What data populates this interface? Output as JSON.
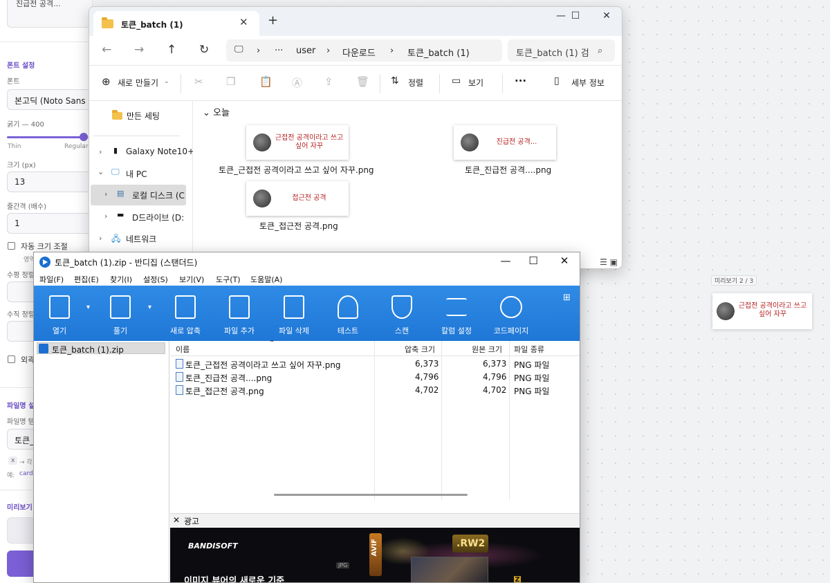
{
  "left_panel": {
    "top_box_text": "진급전 공격...",
    "font_section": "폰트 설정",
    "font_label": "폰트",
    "font_value": "본고딕 (Noto Sans KR)",
    "weight_label": "굵기 — 400",
    "weight_level": 0.8,
    "weight_min": "Thin",
    "weight_mid": "Regular",
    "size_label": "크기 (px)",
    "size_value": "13",
    "line_label": "줄간격 (배수)",
    "line_value": "1",
    "autosize_label": "자동 크기 조절",
    "autosize_sub": "영역",
    "halign_label": "수평 정렬",
    "valign_label": "수직 정렬",
    "outline_label": "외곽",
    "filename_section": "파일명 설",
    "filename_template_label": "파일명 템",
    "filename_value": "토큰_",
    "hint_tag": "x",
    "hint_text": "→ 각",
    "example_label": "예:",
    "example_value": "card",
    "preview_section": "미리보기"
  },
  "explorer": {
    "tab_title": "토큰_batch (1)",
    "tab_close": "✕",
    "new_tab": "+",
    "breadcrumb": [
      "user",
      "다운로드",
      "토큰_batch (1)"
    ],
    "ellipsis": "···",
    "search_placeholder": "토큰_batch (1) 검",
    "toolbar": {
      "new": "새로 만들기",
      "sort": "정렬",
      "view": "보기",
      "more": "···",
      "details": "세부 정보"
    },
    "nav": {
      "made_settings": "만든 세팅",
      "galaxy": "Galaxy Note10+",
      "my_pc": "내 PC",
      "local_disk": "로컬 디스크 (C",
      "d_drive": "D드라이브 (D:",
      "network": "네트워크"
    },
    "group_header": "오늘",
    "files": [
      {
        "thumb_text": "근접전 공격이라고 쓰고 싶어 자꾸",
        "name": "토큰_근접전 공격이라고 쓰고 싶어 자꾸.png"
      },
      {
        "thumb_text": "진급전 공격...",
        "name": "토큰_진급전 공격....png"
      },
      {
        "thumb_text": "접근전 공격",
        "name": "토큰_접근전 공격.png"
      }
    ]
  },
  "preview": {
    "label": "미리보기 2 / 3",
    "text": "근접전 공격이라고 쓰고 싶어 자꾸"
  },
  "bandizip": {
    "title": "토큰_batch (1).zip - 반디집 (스탠더드)",
    "menu": [
      "파일(F)",
      "편집(E)",
      "찾기(I)",
      "설정(S)",
      "보기(V)",
      "도구(T)",
      "도움말(A)"
    ],
    "ribbon": [
      "열기",
      "풀기",
      "새로 압축",
      "파일 추가",
      "파일 삭제",
      "테스트",
      "스캔",
      "칼럼 설정",
      "코드페이지"
    ],
    "tree_item": "토큰_batch (1).zip",
    "columns": {
      "name": "이름",
      "compressed": "압축 크기",
      "original": "원본 크기",
      "type": "파일 종류"
    },
    "rows": [
      {
        "name": "토큰_근접전 공격이라고 쓰고 싶어 자꾸.png",
        "compressed": "6,373",
        "original": "6,373",
        "type": "PNG 파일"
      },
      {
        "name": "토큰_진급전 공격....png",
        "compressed": "4,796",
        "original": "4,796",
        "type": "PNG 파일"
      },
      {
        "name": "토큰_접근전 공격.png",
        "compressed": "4,702",
        "original": "4,702",
        "type": "PNG 파일"
      }
    ],
    "ad_label": "광고",
    "ad_logo": "BANDISOFT",
    "ad_headline": "이미지 뷰어의 새로운 기준",
    "ad_tags": [
      "AVIF",
      ".RW2",
      "JPG",
      "Z"
    ]
  },
  "colors": {
    "accent_purple": "#7b5fd6",
    "bandizip_blue": "#1f77d6",
    "thumb_red": "#b41e1e"
  }
}
